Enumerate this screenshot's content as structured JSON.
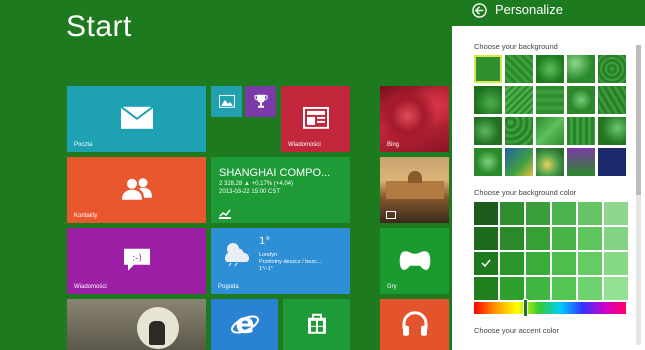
{
  "start": {
    "title": "Start"
  },
  "tiles": {
    "mail": {
      "label": "Poczta",
      "color": "#1ea1b3",
      "icon": "mail-icon"
    },
    "photos": {
      "color": "#21a0b0",
      "icon": "photos-icon"
    },
    "games_small": {
      "color": "#7a3aa8",
      "icon": "trophy-icon"
    },
    "news": {
      "label": "Wiadomości",
      "color": "#c1263b",
      "icon": "newspaper-icon"
    },
    "bing": {
      "label": "Bing",
      "icon": "bing-icon"
    },
    "people": {
      "label": "Kontakty",
      "color": "#e9572f",
      "icon": "people-icon"
    },
    "finance": {
      "color": "#1e9a37",
      "title": "SHANGHAI COMPO...",
      "line1": "2 328,28  ▲ +0,17% (+4,04)",
      "line2": "2013-03-22 15:00 CST",
      "icon": "chart-icon"
    },
    "messaging": {
      "label": "Wiadomości",
      "color": "#9c1fa5",
      "icon": "chat-icon"
    },
    "weather": {
      "label": "Pogoda",
      "color": "#2e8ed6",
      "temp": "1°",
      "city": "Londyn",
      "desc": "Przelotny deszcz / bezc...",
      "range": "1°/-1°",
      "icon": "weather-icon"
    },
    "games": {
      "label": "Gry",
      "color": "#1a9a2f",
      "icon": "gamepad-icon"
    },
    "ie": {
      "color": "#2a82d2",
      "icon": "internet-explorer-icon"
    },
    "store": {
      "color": "#1e9a37",
      "icon": "store-icon"
    },
    "music": {
      "color": "#e4542c",
      "icon": "headphones-icon"
    }
  },
  "panel": {
    "title": "Personalize",
    "background_label": "Choose your background",
    "bg_color_label": "Choose your background color",
    "accent_label": "Choose your accent color",
    "accent_color": "#1e7a1e"
  }
}
